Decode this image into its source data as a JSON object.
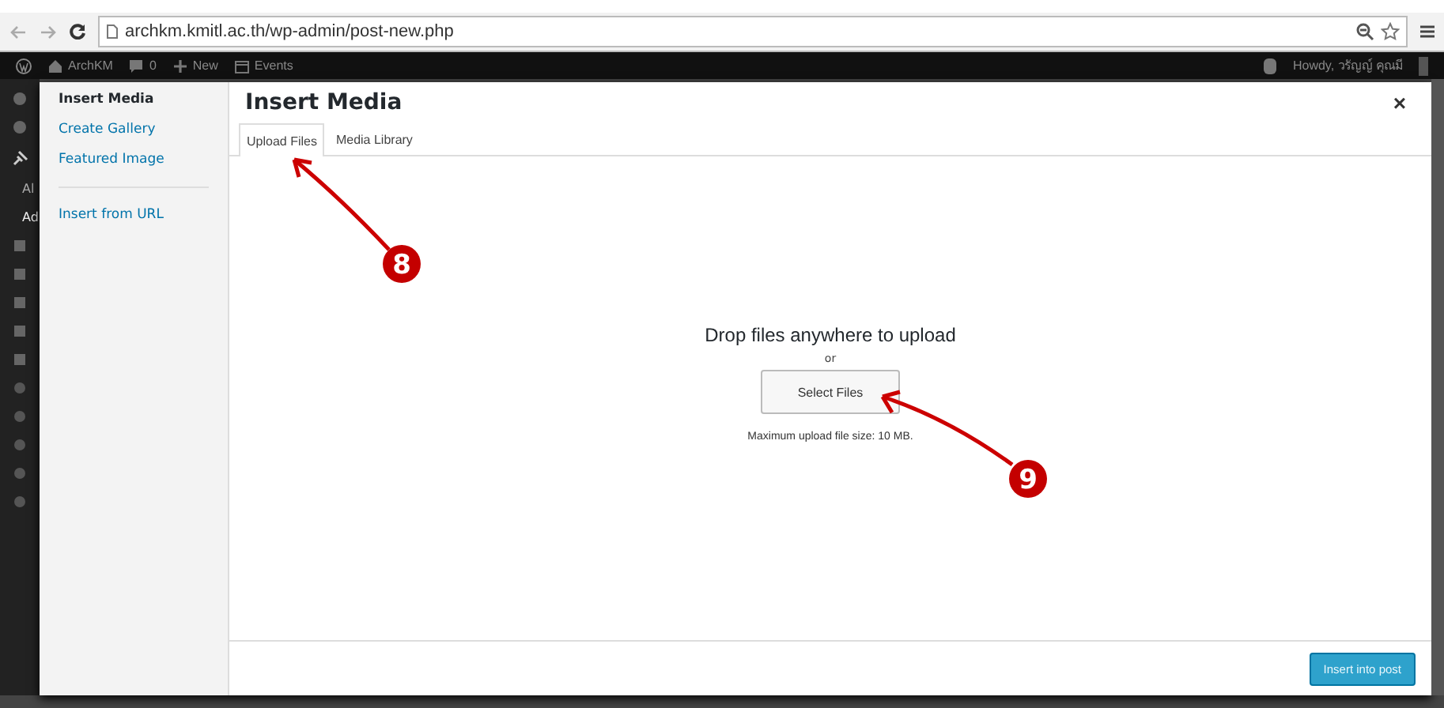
{
  "browser": {
    "url": "archkm.kmitl.ac.th/wp-admin/post-new.php"
  },
  "admin_bar": {
    "items": [
      {
        "kind": "home",
        "label": "ArchKM"
      },
      {
        "kind": "comments",
        "label": "0"
      },
      {
        "kind": "new",
        "label": "New"
      },
      {
        "kind": "events",
        "label": "Events"
      }
    ],
    "greeting": "Howdy, วรัญญ์ คุณมี"
  },
  "admin_menu": {
    "texts": [
      "Al",
      "Ad"
    ]
  },
  "modal": {
    "sidebar": [
      {
        "label": "Insert Media",
        "selected": true
      },
      {
        "label": "Create Gallery",
        "selected": false
      },
      {
        "label": "Featured Image",
        "selected": false
      },
      {
        "kind": "separator"
      },
      {
        "label": "Insert from URL",
        "selected": false
      }
    ],
    "title": "Insert Media",
    "close": "×",
    "tabs": [
      {
        "label": "Upload Files",
        "selected": true
      },
      {
        "label": "Media Library",
        "selected": false
      }
    ],
    "upload": {
      "heading": "Drop files anywhere to upload",
      "or": "or",
      "button": "Select Files",
      "note": "Maximum upload file size: 10 MB."
    },
    "footer_button": "Insert into post"
  },
  "annotations": [
    {
      "label": "8"
    },
    {
      "label": "9"
    }
  ]
}
